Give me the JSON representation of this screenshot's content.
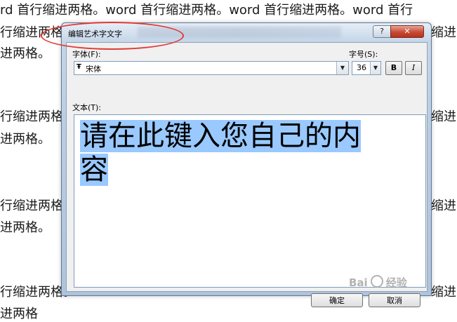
{
  "document": {
    "lines": [
      "rd 首行缩进两格。word 首行缩进两格。word 首行缩进两格。word 首行",
      "行缩进两格。",
      "进两格。",
      "行缩进两格。",
      "进两格。",
      "行缩进两格。",
      "进两格。",
      "行缩进两格。",
      "进两格"
    ],
    "right_fragments": [
      "缩进",
      "缩进",
      "缩进",
      "缩进"
    ]
  },
  "dialog": {
    "title": "编辑艺术字文字",
    "help_label": "?",
    "close_label": "✕",
    "font_label": "字体(F):",
    "font_value": "宋体",
    "font_type_glyph": "Ŧ",
    "size_label": "字号(S):",
    "size_value": "36",
    "bold_label": "B",
    "italic_label": "I",
    "text_label": "文本(T):",
    "text_line1": "请在此键入您自己的内",
    "text_line2": "容",
    "ok_label": "确定",
    "cancel_label": "取消"
  },
  "watermark": {
    "text": "Bai",
    "suffix": "经验"
  },
  "colors": {
    "selection": "#99c9ff",
    "annotation": "#e23a37"
  }
}
